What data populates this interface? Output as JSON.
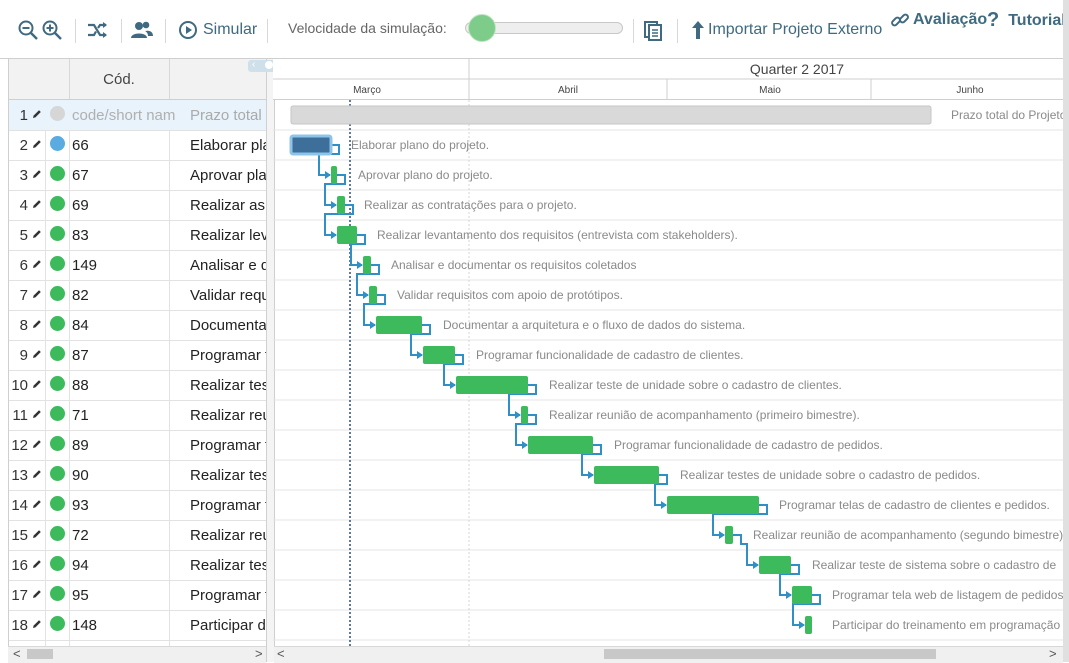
{
  "toolbar": {
    "zoom_out_icon": "zoom-out-icon",
    "zoom_in_icon": "zoom-in-icon",
    "simulate_label": "Simular",
    "speed_label": "Velocidade da simulação:",
    "import_label": "Importar Projeto Externo",
    "evaluation_label": "Avaliação",
    "tutorial_label": "Tutorial",
    "speed_value": 0.1
  },
  "grid": {
    "col_cod": "Cód.",
    "rows": [
      {
        "num": "1",
        "status": "gray",
        "cod": "code/short nam",
        "name": "Prazo total do"
      },
      {
        "num": "2",
        "status": "blue",
        "cod": "66",
        "name": "Elaborar pla"
      },
      {
        "num": "3",
        "status": "green",
        "cod": "67",
        "name": "Aprovar plan"
      },
      {
        "num": "4",
        "status": "green",
        "cod": "69",
        "name": "Realizar as c"
      },
      {
        "num": "5",
        "status": "green",
        "cod": "83",
        "name": "Realizar leva"
      },
      {
        "num": "6",
        "status": "green",
        "cod": "149",
        "name": "Analisar e do"
      },
      {
        "num": "7",
        "status": "green",
        "cod": "82",
        "name": "Validar requi"
      },
      {
        "num": "8",
        "status": "green",
        "cod": "84",
        "name": "Documentar"
      },
      {
        "num": "9",
        "status": "green",
        "cod": "87",
        "name": "Programar fu"
      },
      {
        "num": "10",
        "status": "green",
        "cod": "88",
        "name": "Realizar test"
      },
      {
        "num": "11",
        "status": "green",
        "cod": "71",
        "name": "Realizar reun"
      },
      {
        "num": "12",
        "status": "green",
        "cod": "89",
        "name": "Programar fu"
      },
      {
        "num": "13",
        "status": "green",
        "cod": "90",
        "name": "Realizar test"
      },
      {
        "num": "14",
        "status": "green",
        "cod": "93",
        "name": "Programar te"
      },
      {
        "num": "15",
        "status": "green",
        "cod": "72",
        "name": "Realizar reur"
      },
      {
        "num": "16",
        "status": "green",
        "cod": "94",
        "name": "Realizar test"
      },
      {
        "num": "17",
        "status": "green",
        "cod": "95",
        "name": "Programar te"
      },
      {
        "num": "18",
        "status": "green",
        "cod": "148",
        "name": "Participar do"
      }
    ]
  },
  "timeline": {
    "quarter_label": "Quarter 2 2017",
    "months": [
      "Março",
      "Abril",
      "Maio",
      "Junho"
    ],
    "tasks": [
      {
        "label": "Prazo total do Projeto"
      },
      {
        "label": "Elaborar plano do projeto."
      },
      {
        "label": "Aprovar plano do projeto."
      },
      {
        "label": "Realizar as contratações para o projeto."
      },
      {
        "label": "Realizar levantamento dos requisitos (entrevista com stakeholders)."
      },
      {
        "label": "Analisar e documentar os requisitos coletados"
      },
      {
        "label": "Validar requisitos com apoio de protótipos."
      },
      {
        "label": "Documentar a arquitetura e o fluxo de dados do sistema."
      },
      {
        "label": "Programar funcionalidade de cadastro de clientes."
      },
      {
        "label": "Realizar teste de unidade sobre o cadastro de clientes."
      },
      {
        "label": "Realizar reunião de acompanhamento (primeiro bimestre)."
      },
      {
        "label": "Programar funcionalidade de cadastro de pedidos."
      },
      {
        "label": "Realizar testes de unidade sobre o cadastro de pedidos."
      },
      {
        "label": "Programar telas de cadastro de clientes e pedidos."
      },
      {
        "label": "Realizar reunião de acompanhamento (segundo bimestre)."
      },
      {
        "label": "Realizar teste de sistema sobre o cadastro de"
      },
      {
        "label": "Programar tela web de listagem de pedidos"
      },
      {
        "label": "Participar do treinamento em programação"
      }
    ]
  },
  "colors": {
    "accent": "#3f6a80",
    "green": "#3cba5c",
    "blue_task": "#3d6f9a",
    "link": "#2f8fc6"
  }
}
